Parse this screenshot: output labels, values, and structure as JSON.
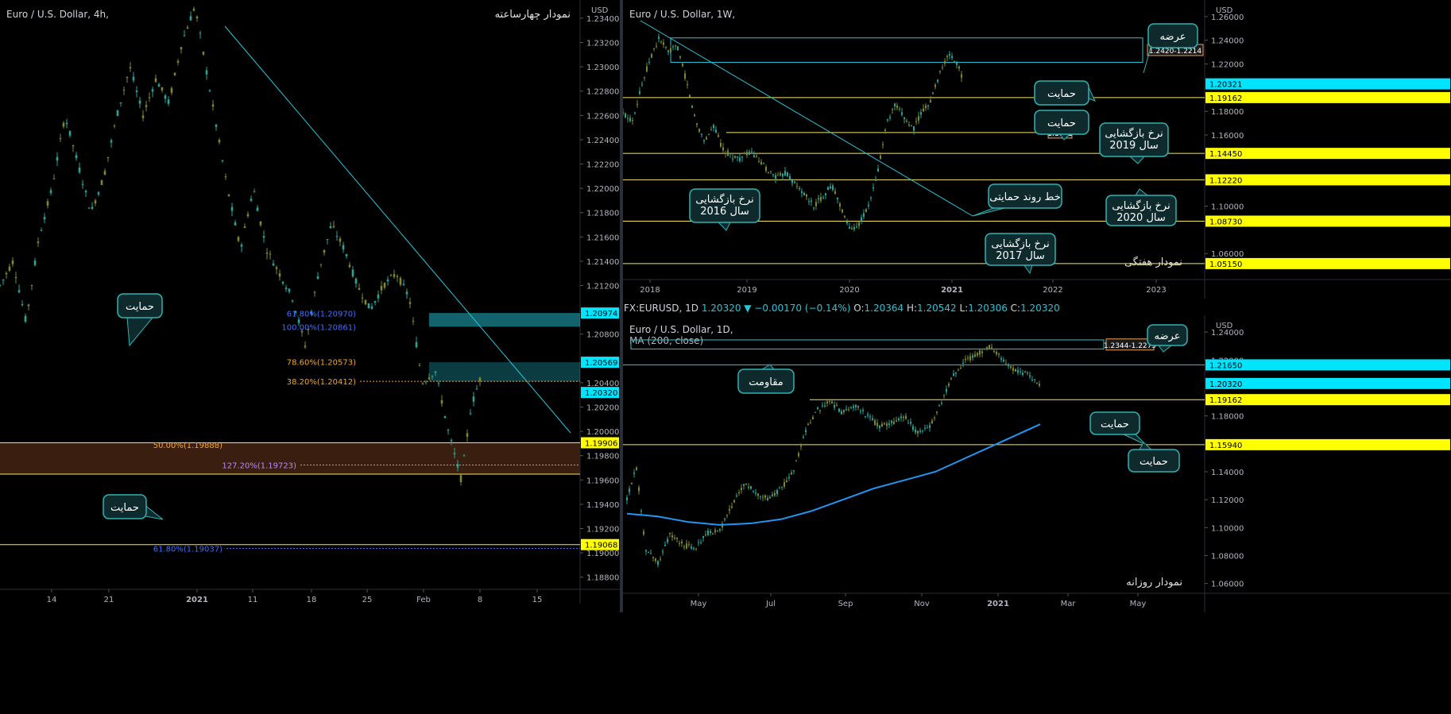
{
  "colors": {
    "background": "#000000",
    "bull": "#26a69a",
    "bear": "#7b8a2a",
    "grid": "#131722",
    "cyan": "#26c6da",
    "yellow": "#f5e663",
    "ma": "#2196f3",
    "fibBlue": "#3d6fff",
    "fibOrange": "#f5a623",
    "fibPurple": "#b388ff",
    "zone": "#3a1e10",
    "callout": "#1b6b6b"
  },
  "ohlc_bar": {
    "symbol": "FX:EURUSD, 1D",
    "close": "1.20320",
    "change": "−0.00170 (−0.14%)",
    "o_label": "O:",
    "o": "1.20364",
    "h_label": "H:",
    "h": "1.20542",
    "l_label": "L:",
    "l": "1.20306",
    "c_label": "C:",
    "c": "1.20320"
  },
  "chart_data": [
    {
      "id": "chart-4h",
      "type": "candlestick",
      "title": "Euro / U.S. Dollar, 4h,",
      "annotation_title": "نمودار چهارساعته",
      "currency": "USD",
      "ylim": [
        1.187,
        1.2355
      ],
      "x_ticks": [
        "14",
        "21",
        "2021",
        "11",
        "18",
        "25",
        "Feb",
        "8",
        "15"
      ],
      "y_ticks": [
        1.234,
        1.232,
        1.23,
        1.228,
        1.226,
        1.224,
        1.222,
        1.22,
        1.218,
        1.216,
        1.214,
        1.212,
        1.208,
        1.204,
        1.202,
        1.2,
        1.198,
        1.196,
        1.194,
        1.192,
        1.19,
        1.188
      ],
      "price_labels": [
        {
          "value": 1.20974,
          "text": "1.20974",
          "style": "cyan"
        },
        {
          "value": 1.20569,
          "text": "1.20569",
          "style": "cyan"
        },
        {
          "value": 1.2032,
          "text": "1.20320",
          "style": "cyan"
        },
        {
          "value": 1.19906,
          "text": "1.19906",
          "style": "yellow"
        },
        {
          "value": 1.19068,
          "text": "1.19068",
          "style": "yellow"
        }
      ],
      "fib_labels": [
        {
          "text": "61.80%(1.20970)",
          "value": 1.2097,
          "color": "blue"
        },
        {
          "text": "100.00%(1.20861)",
          "value": 1.20861,
          "color": "blue"
        },
        {
          "text": "78.60%(1.20573)",
          "value": 1.20573,
          "color": "orange"
        },
        {
          "text": "38.20%(1.20412)",
          "value": 1.20412,
          "color": "orange"
        },
        {
          "text": "50.00%(1.19888)",
          "value": 1.19888,
          "color": "orange"
        },
        {
          "text": "127.20%(1.19723)",
          "value": 1.19723,
          "color": "purple"
        },
        {
          "text": "61.80%(1.19037)",
          "value": 1.19037,
          "color": "blue"
        }
      ],
      "callouts": [
        {
          "text": "حمایت"
        },
        {
          "text": "حمایت"
        }
      ],
      "price_path": [
        [
          0,
          1.212
        ],
        [
          4,
          1.214
        ],
        [
          8,
          1.209
        ],
        [
          12,
          1.216
        ],
        [
          16,
          1.22
        ],
        [
          20,
          1.226
        ],
        [
          24,
          1.222
        ],
        [
          28,
          1.218
        ],
        [
          32,
          1.221
        ],
        [
          36,
          1.226
        ],
        [
          40,
          1.23
        ],
        [
          44,
          1.226
        ],
        [
          48,
          1.229
        ],
        [
          52,
          1.227
        ],
        [
          56,
          1.232
        ],
        [
          60,
          1.235
        ],
        [
          62,
          1.232
        ],
        [
          66,
          1.226
        ],
        [
          70,
          1.22
        ],
        [
          74,
          1.215
        ],
        [
          78,
          1.22
        ],
        [
          82,
          1.215
        ],
        [
          86,
          1.213
        ],
        [
          90,
          1.211
        ],
        [
          94,
          1.207
        ],
        [
          98,
          1.213
        ],
        [
          102,
          1.217
        ],
        [
          106,
          1.215
        ],
        [
          110,
          1.212
        ],
        [
          114,
          1.21
        ],
        [
          118,
          1.212
        ],
        [
          122,
          1.213
        ],
        [
          126,
          1.211
        ],
        [
          130,
          1.204
        ],
        [
          134,
          1.205
        ],
        [
          138,
          1.2
        ],
        [
          142,
          1.196
        ],
        [
          145,
          1.202
        ],
        [
          148,
          1.2045
        ]
      ]
    },
    {
      "id": "chart-1w",
      "type": "candlestick",
      "title": "Euro / U.S. Dollar, 1W,",
      "annotation_title": "نمودار هفتگی",
      "currency": "USD",
      "ylim": [
        1.038,
        1.274
      ],
      "x_ticks": [
        "2018",
        "2019",
        "2020",
        "2021",
        "2022",
        "2023"
      ],
      "y_ticks": [
        1.26,
        1.24,
        1.22,
        1.18,
        1.16,
        1.1,
        1.06
      ],
      "price_labels": [
        {
          "value": 1.20321,
          "text": "1.20321",
          "style": "cyan"
        },
        {
          "value": 1.19162,
          "text": "1.19162",
          "style": "yellow"
        },
        {
          "value": 1.1445,
          "text": "1.14450",
          "style": "yellow"
        },
        {
          "value": 1.1222,
          "text": "1.12220",
          "style": "yellow"
        },
        {
          "value": 1.0873,
          "text": "1.08730",
          "style": "yellow"
        },
        {
          "value": 1.0515,
          "text": "1.05150",
          "style": "yellow"
        }
      ],
      "box_label": "1.2420-1.2214",
      "line_label": "1.1621",
      "callouts": [
        {
          "text": "عرضه"
        },
        {
          "text": "حمایت"
        },
        {
          "text": "حمایت"
        },
        {
          "text": "نرخ بازگشایی",
          "text2": "سال 2019"
        },
        {
          "text": "خط روند حمایتی"
        },
        {
          "text": "نرخ بازگشایی",
          "text2": "سال 2016"
        },
        {
          "text": "نرخ بازگشایی",
          "text2": "سال 2020"
        },
        {
          "text": "نرخ بازگشایی",
          "text2": "سال 2017"
        }
      ],
      "price_path": [
        [
          0,
          1.178
        ],
        [
          4,
          1.172
        ],
        [
          8,
          1.2
        ],
        [
          12,
          1.225
        ],
        [
          16,
          1.242
        ],
        [
          20,
          1.23
        ],
        [
          24,
          1.235
        ],
        [
          28,
          1.205
        ],
        [
          32,
          1.172
        ],
        [
          36,
          1.155
        ],
        [
          40,
          1.168
        ],
        [
          44,
          1.148
        ],
        [
          48,
          1.142
        ],
        [
          52,
          1.14
        ],
        [
          56,
          1.146
        ],
        [
          60,
          1.138
        ],
        [
          64,
          1.13
        ],
        [
          68,
          1.124
        ],
        [
          72,
          1.128
        ],
        [
          76,
          1.118
        ],
        [
          80,
          1.11
        ],
        [
          84,
          1.1
        ],
        [
          88,
          1.108
        ],
        [
          92,
          1.118
        ],
        [
          96,
          1.1
        ],
        [
          100,
          1.08
        ],
        [
          104,
          1.085
        ],
        [
          108,
          1.098
        ],
        [
          112,
          1.125
        ],
        [
          116,
          1.168
        ],
        [
          120,
          1.185
        ],
        [
          124,
          1.175
        ],
        [
          128,
          1.165
        ],
        [
          132,
          1.18
        ],
        [
          136,
          1.19
        ],
        [
          140,
          1.215
        ],
        [
          144,
          1.228
        ],
        [
          148,
          1.218
        ],
        [
          150,
          1.205
        ]
      ]
    },
    {
      "id": "chart-1d",
      "type": "candlestick",
      "title": "Euro / U.S. Dollar, 1D,",
      "subtitle": "MA (200, close)",
      "annotation_title": "نمودار روزانه",
      "currency": "USD",
      "ylim": [
        1.053,
        1.252
      ],
      "x_ticks": [
        "May",
        "Jul",
        "Sep",
        "Nov",
        "2021",
        "Mar",
        "May"
      ],
      "y_ticks": [
        1.24,
        1.22,
        1.18,
        1.14,
        1.12,
        1.1,
        1.08,
        1.06
      ],
      "price_labels": [
        {
          "value": 1.2165,
          "text": "1.21650",
          "style": "cyan"
        },
        {
          "value": 1.2032,
          "text": "1.20320",
          "style": "cyan"
        },
        {
          "value": 1.19162,
          "text": "1.19162",
          "style": "yellow"
        },
        {
          "value": 1.1594,
          "text": "1.15940",
          "style": "yellow"
        }
      ],
      "box_label": "1.2344-1.2279",
      "callouts": [
        {
          "text": "عرضه"
        },
        {
          "text": "مقاومت"
        },
        {
          "text": "حمایت"
        },
        {
          "text": "حمایت"
        }
      ],
      "price_path": [
        [
          0,
          1.12
        ],
        [
          3,
          1.145
        ],
        [
          6,
          1.085
        ],
        [
          10,
          1.075
        ],
        [
          14,
          1.095
        ],
        [
          18,
          1.088
        ],
        [
          22,
          1.085
        ],
        [
          26,
          1.096
        ],
        [
          30,
          1.098
        ],
        [
          34,
          1.115
        ],
        [
          38,
          1.132
        ],
        [
          42,
          1.125
        ],
        [
          46,
          1.12
        ],
        [
          50,
          1.128
        ],
        [
          54,
          1.14
        ],
        [
          58,
          1.17
        ],
        [
          62,
          1.185
        ],
        [
          66,
          1.19
        ],
        [
          70,
          1.182
        ],
        [
          74,
          1.188
        ],
        [
          78,
          1.18
        ],
        [
          82,
          1.172
        ],
        [
          86,
          1.175
        ],
        [
          90,
          1.18
        ],
        [
          94,
          1.168
        ],
        [
          98,
          1.172
        ],
        [
          102,
          1.19
        ],
        [
          106,
          1.21
        ],
        [
          110,
          1.22
        ],
        [
          114,
          1.225
        ],
        [
          118,
          1.23
        ],
        [
          122,
          1.22
        ],
        [
          126,
          1.212
        ],
        [
          130,
          1.21
        ],
        [
          134,
          1.202
        ]
      ],
      "ma_path": [
        [
          0,
          1.11
        ],
        [
          10,
          1.108
        ],
        [
          20,
          1.104
        ],
        [
          30,
          1.102
        ],
        [
          40,
          1.103
        ],
        [
          50,
          1.106
        ],
        [
          60,
          1.112
        ],
        [
          70,
          1.12
        ],
        [
          80,
          1.128
        ],
        [
          90,
          1.134
        ],
        [
          100,
          1.14
        ],
        [
          110,
          1.15
        ],
        [
          120,
          1.16
        ],
        [
          130,
          1.17
        ],
        [
          134,
          1.174
        ]
      ]
    }
  ]
}
